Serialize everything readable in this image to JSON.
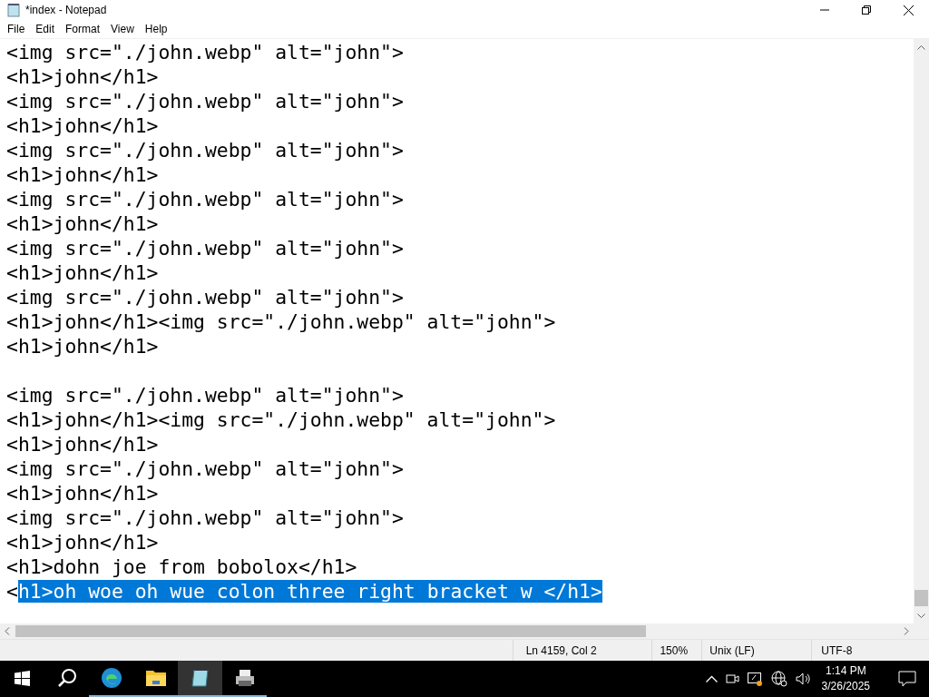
{
  "window": {
    "title": "*index - Notepad"
  },
  "menu": [
    "File",
    "Edit",
    "Format",
    "View",
    "Help"
  ],
  "lines": [
    {
      "kind": "text",
      "segments": [
        {
          "text": "<img src=\"./john.webp\" alt=\"john\">",
          "selected": false
        }
      ]
    },
    {
      "kind": "text",
      "segments": [
        {
          "text": "<h1>john</h1>",
          "selected": false
        }
      ]
    },
    {
      "kind": "text",
      "segments": [
        {
          "text": "<img src=\"./john.webp\" alt=\"john\">",
          "selected": false
        }
      ]
    },
    {
      "kind": "text",
      "segments": [
        {
          "text": "<h1>john</h1>",
          "selected": false
        }
      ]
    },
    {
      "kind": "text",
      "segments": [
        {
          "text": "<img src=\"./john.webp\" alt=\"john\">",
          "selected": false
        }
      ]
    },
    {
      "kind": "text",
      "segments": [
        {
          "text": "<h1>john</h1>",
          "selected": false
        }
      ]
    },
    {
      "kind": "text",
      "segments": [
        {
          "text": "<img src=\"./john.webp\" alt=\"john\">",
          "selected": false
        }
      ]
    },
    {
      "kind": "text",
      "segments": [
        {
          "text": "<h1>john</h1>",
          "selected": false
        }
      ]
    },
    {
      "kind": "text",
      "segments": [
        {
          "text": "<img src=\"./john.webp\" alt=\"john\">",
          "selected": false
        }
      ]
    },
    {
      "kind": "text",
      "segments": [
        {
          "text": "<h1>john</h1>",
          "selected": false
        }
      ]
    },
    {
      "kind": "text",
      "segments": [
        {
          "text": "<img src=\"./john.webp\" alt=\"john\">",
          "selected": false
        }
      ]
    },
    {
      "kind": "text",
      "segments": [
        {
          "text": "<h1>john</h1><img src=\"./john.webp\" alt=\"john\">",
          "selected": false
        }
      ]
    },
    {
      "kind": "text",
      "segments": [
        {
          "text": "<h1>john</h1>",
          "selected": false
        }
      ]
    },
    {
      "kind": "blank"
    },
    {
      "kind": "text",
      "segments": [
        {
          "text": "<img src=\"./john.webp\" alt=\"john\">",
          "selected": false
        }
      ]
    },
    {
      "kind": "text",
      "segments": [
        {
          "text": "<h1>john</h1><img src=\"./john.webp\" alt=\"john\">",
          "selected": false
        }
      ]
    },
    {
      "kind": "text",
      "segments": [
        {
          "text": "<h1>john</h1>",
          "selected": false
        }
      ]
    },
    {
      "kind": "text",
      "segments": [
        {
          "text": "<img src=\"./john.webp\" alt=\"john\">",
          "selected": false
        }
      ]
    },
    {
      "kind": "text",
      "segments": [
        {
          "text": "<h1>john</h1>",
          "selected": false
        }
      ]
    },
    {
      "kind": "text",
      "segments": [
        {
          "text": "<img src=\"./john.webp\" alt=\"john\">",
          "selected": false
        }
      ]
    },
    {
      "kind": "text",
      "segments": [
        {
          "text": "<h1>john</h1>",
          "selected": false
        }
      ]
    },
    {
      "kind": "text",
      "segments": [
        {
          "text": "<h1>dohn joe from bobolox</h1>",
          "selected": false
        }
      ]
    },
    {
      "kind": "text",
      "segments": [
        {
          "text": "<",
          "selected": false
        },
        {
          "text": "h1>oh woe oh wue colon three right bracket w </h1>",
          "selected": true
        }
      ]
    }
  ],
  "status_bar": [
    "Ln 4159, Col 2",
    "150%",
    "Unix (LF)",
    "UTF-8"
  ],
  "taskbar": {
    "time": "1:14 PM",
    "date": "3/26/2025"
  }
}
